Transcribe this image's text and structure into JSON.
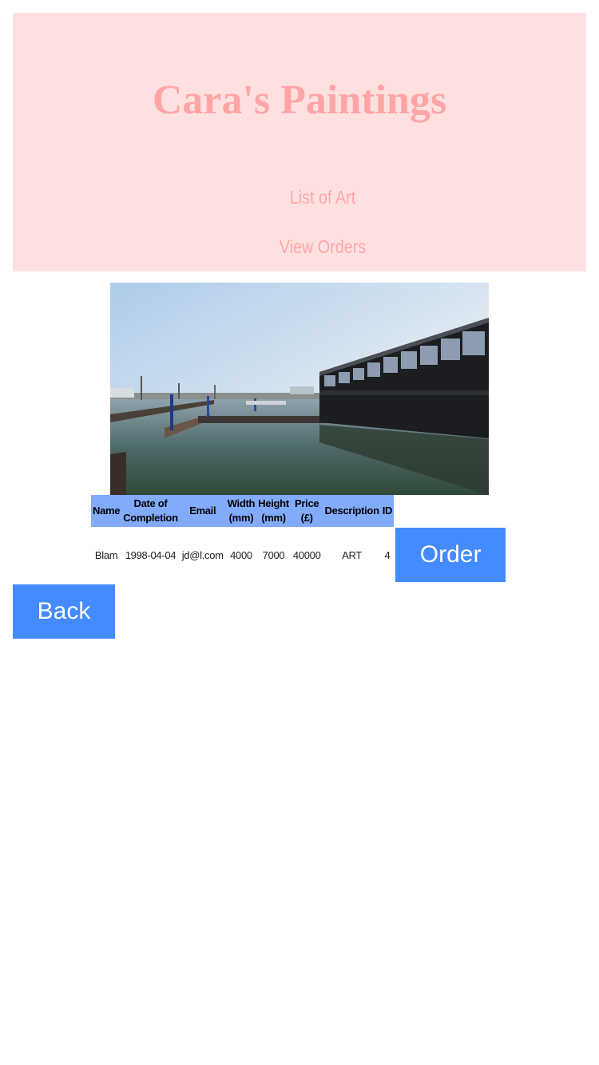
{
  "header": {
    "title": "Cara's Paintings",
    "nav": {
      "list_of_art": "List of Art",
      "view_orders": "View Orders"
    }
  },
  "artwork": {
    "columns": {
      "name": "Name",
      "date_line1": "Date of",
      "date_line2": "Completion",
      "email": "Email",
      "width_line1": "Width",
      "width_line2": "(mm)",
      "height_line1": "Height",
      "height_line2": "(mm)",
      "price_line1": "Price",
      "price_line2": "(£)",
      "description": "Description",
      "id": "ID"
    },
    "row": {
      "name": "Blam",
      "date": "1998-04-04",
      "email": "jd@l.com",
      "width": "4000",
      "height": "7000",
      "price": "40000",
      "description": "ART",
      "id": "4"
    },
    "order_label": "Order"
  },
  "back_label": "Back",
  "colors": {
    "header_bg": "#ffe0e1",
    "header_text": "#ffa5a6",
    "table_header_bg": "#82abfb",
    "button_bg": "#438bff"
  }
}
